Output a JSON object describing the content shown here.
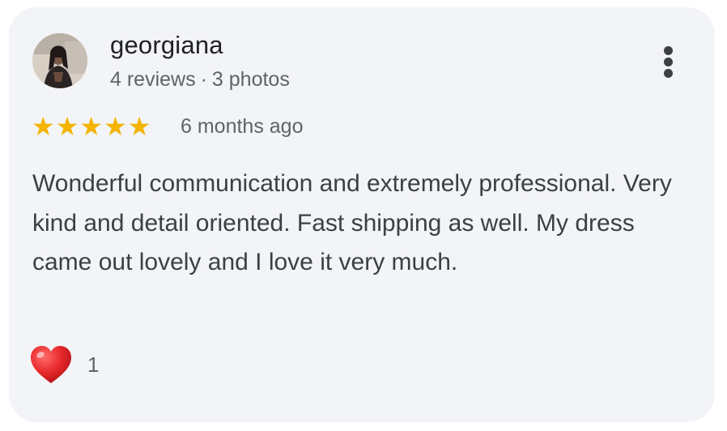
{
  "reviewer": {
    "name": "georgiana",
    "reviews_count": "4 reviews",
    "separator": "·",
    "photos_count": "3 photos",
    "avatar_icon": "profile-photo"
  },
  "rating": {
    "stars": 5,
    "max_stars": 5,
    "star_color": "#f4b400",
    "date": "6 months ago"
  },
  "review": {
    "text": "Wonderful communication and extremely professional. Very kind and detail oriented. Fast shipping as well. My dress came out lovely and I love it very much."
  },
  "reaction": {
    "icon": "heart-icon",
    "count": "1"
  },
  "menu": {
    "icon": "more-vertical-icon"
  },
  "colors": {
    "card_background": "#f3f4f7",
    "text_primary": "#202124",
    "text_secondary": "#5f6368"
  }
}
